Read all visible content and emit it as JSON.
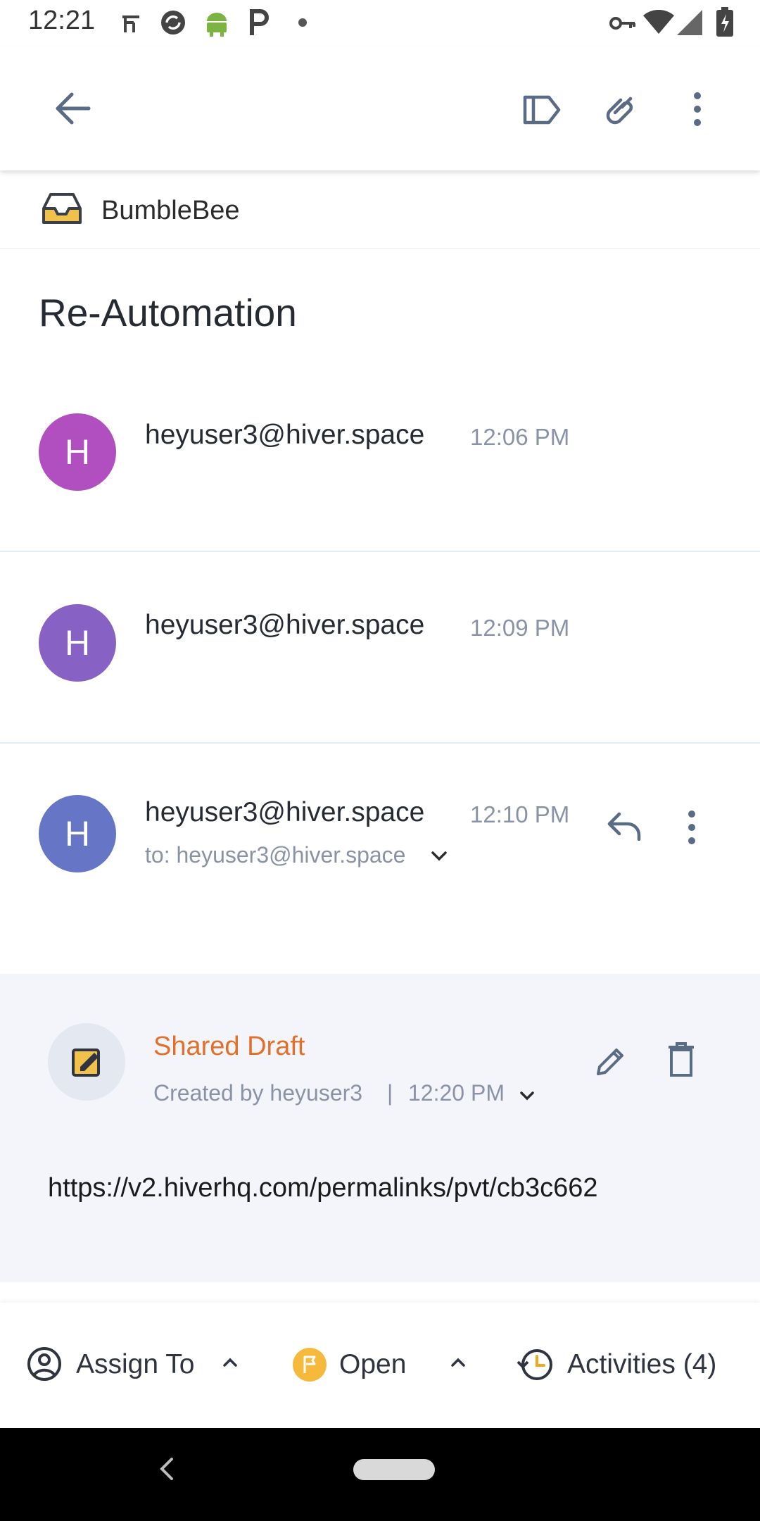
{
  "status_bar": {
    "time": "12:21"
  },
  "app_bar": {
    "back_icon": "arrow-left-icon",
    "label_icon": "label-icon",
    "attach_icon": "paperclip-icon",
    "more_icon": "more-vert-icon"
  },
  "inbox": {
    "name": "BumbleBee",
    "icon": "inbox-tray-icon",
    "icon_color": "#f0c24b"
  },
  "subject": "Re-Automation",
  "messages": [
    {
      "initial": "H",
      "sender": "heyuser3@hiver.space",
      "time": "12:06 PM",
      "avatar_color": "#b24fc0"
    },
    {
      "initial": "H",
      "sender": "heyuser3@hiver.space",
      "time": "12:09 PM",
      "avatar_color": "#8762c4"
    },
    {
      "initial": "H",
      "sender": "heyuser3@hiver.space",
      "time": "12:10 PM",
      "avatar_color": "#6675c5",
      "to": "to: heyuser3@hiver.space"
    }
  ],
  "shared_draft": {
    "title": "Shared Draft",
    "created_by": "Created by heyuser3",
    "separator": "|",
    "time": "12:20 PM",
    "body": "https://v2.hiverhq.com/permalinks/pvt/cb3c662",
    "title_color": "#e2702a"
  },
  "bottom_bar": {
    "assign_label": "Assign To",
    "status_label": "Open",
    "status_color": "#f5b93b",
    "activities_label": "Activities (4)"
  }
}
